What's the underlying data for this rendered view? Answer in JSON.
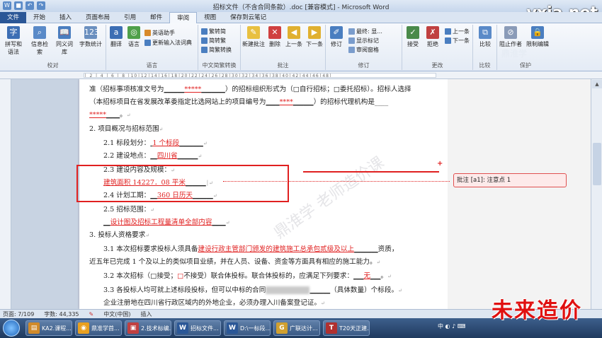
{
  "window": {
    "title": "招标文件（不含合同条款）.doc [兼容模式] - Microsoft Word",
    "watermark": "vxia.net"
  },
  "tabs": [
    "文件",
    "开始",
    "插入",
    "页面布局",
    "引用",
    "邮件",
    "审阅",
    "视图",
    "保存到云笔记"
  ],
  "ribbon": {
    "proofing": {
      "spell": "拼写和语法",
      "info": "信息检索",
      "thesaurus": "同义词库",
      "wordcount": "字数统计",
      "label": "校对"
    },
    "language": {
      "translate": "翻译",
      "lang": "语言",
      "eng_assist": "英语助手",
      "update_ime": "更新输入法词典",
      "label": "语言"
    },
    "chinese": {
      "t2s": "繁转简",
      "s2t": "简转繁",
      "convert": "简繁转换",
      "label": "中文简繁转换"
    },
    "comments": {
      "new": "新建批注",
      "delete": "删除",
      "prev": "上一条",
      "next": "下一条",
      "label": "批注"
    },
    "tracking": {
      "track": "修订",
      "final": "最终: 显...",
      "show_markup": "显示标记",
      "review_pane": "审阅窗格",
      "label": "修订"
    },
    "changes": {
      "accept": "接受",
      "reject": "拒绝",
      "prev": "上一条",
      "next": "下一条",
      "label": "更改"
    },
    "compare": {
      "compare": "比较",
      "label": "比较"
    },
    "protect": {
      "block": "阻止作者",
      "restrict": "限制编辑",
      "label": "保护"
    },
    "side_watermark": "鼎淮学"
  },
  "document": {
    "lines": [
      {
        "pre": "准（招标事项核准文号为",
        "red": "*****",
        "post": "）的招标组织形式为（□自行招标；□委托招标）。招标人选择"
      },
      {
        "pre": "（本招标项目在省发展改革委指定比选网站上的项目编号为",
        "red": "****",
        "post": "）的招标代理机构是____"
      },
      {
        "pre": "",
        "red": "*****",
        "post": "。"
      },
      {
        "heading": "2. 项目概况与招标范围"
      },
      {
        "pre": "2.1 标段划分：",
        "red": "1 个标段",
        "post": ""
      },
      {
        "pre": "2.2 建设地点：",
        "red": "四川省",
        "post": ""
      },
      {
        "pre": "2.3 建设内容及规模：",
        "red": "",
        "post": ""
      },
      {
        "pre": "",
        "red": "建筑面积 14227．08 平米",
        "post": ""
      },
      {
        "pre": "2.4 计划工期：",
        "red": "360 日历天",
        "post": ""
      },
      {
        "pre": "2.5 招标范围：",
        "red": "",
        "post": ""
      },
      {
        "pre": "",
        "red": "设计图及招标工程量清单全部内容",
        "post": ""
      },
      {
        "heading": "3. 投标人资格要求"
      },
      {
        "pre": "3.1 本次招标要求投标人须具备",
        "red": "建设行政主管部门颁发的建筑施工总承包贰级及以上",
        "post": "资质，"
      },
      {
        "pre": "近五年已完成 1 个及以上的类似项目业绩，并在人员、设备、资金等方面具有相应的施工能力。",
        "red": "",
        "post": ""
      },
      {
        "pre": "3.2 本次招标（□接受；",
        "red": "□",
        "post": "不接受）联合体投标。联合体投标的，应满足下列要求："
      },
      {
        "pre": "3.3 各投标人均可就上述标段投标，但可以中标的合同",
        "red": "",
        "post": "（具体数量）个标段。"
      },
      {
        "pre": "企业注册地在四川省行政区域内的外地企业，必须办理入川备案登记证。",
        "red": "",
        "post": ""
      }
    ],
    "answer_wu": "无",
    "comment": "批注 [a1]: 注意点 1",
    "doc_watermark": "鼎淮学 老师造价课"
  },
  "status": {
    "page": "页面: 7/109",
    "words": "字数: 44,335",
    "lang": "中文(中国)",
    "mode": "插入"
  },
  "taskbar": {
    "items": [
      {
        "label": "KA2.课程...",
        "color": "#d08a2a"
      },
      {
        "label": "鼎准学首...",
        "color": "#e8a020"
      },
      {
        "label": "2.技术标编...",
        "color": "#c04040"
      },
      {
        "label": "招标文件...",
        "color": "#2b5797"
      },
      {
        "label": "D:\\一标段...",
        "color": "#2b5797"
      },
      {
        "label": "广联达计...",
        "color": "#d0a030"
      },
      {
        "label": "T20天正建...",
        "color": "#b03030"
      }
    ],
    "brand": "未来造价"
  }
}
